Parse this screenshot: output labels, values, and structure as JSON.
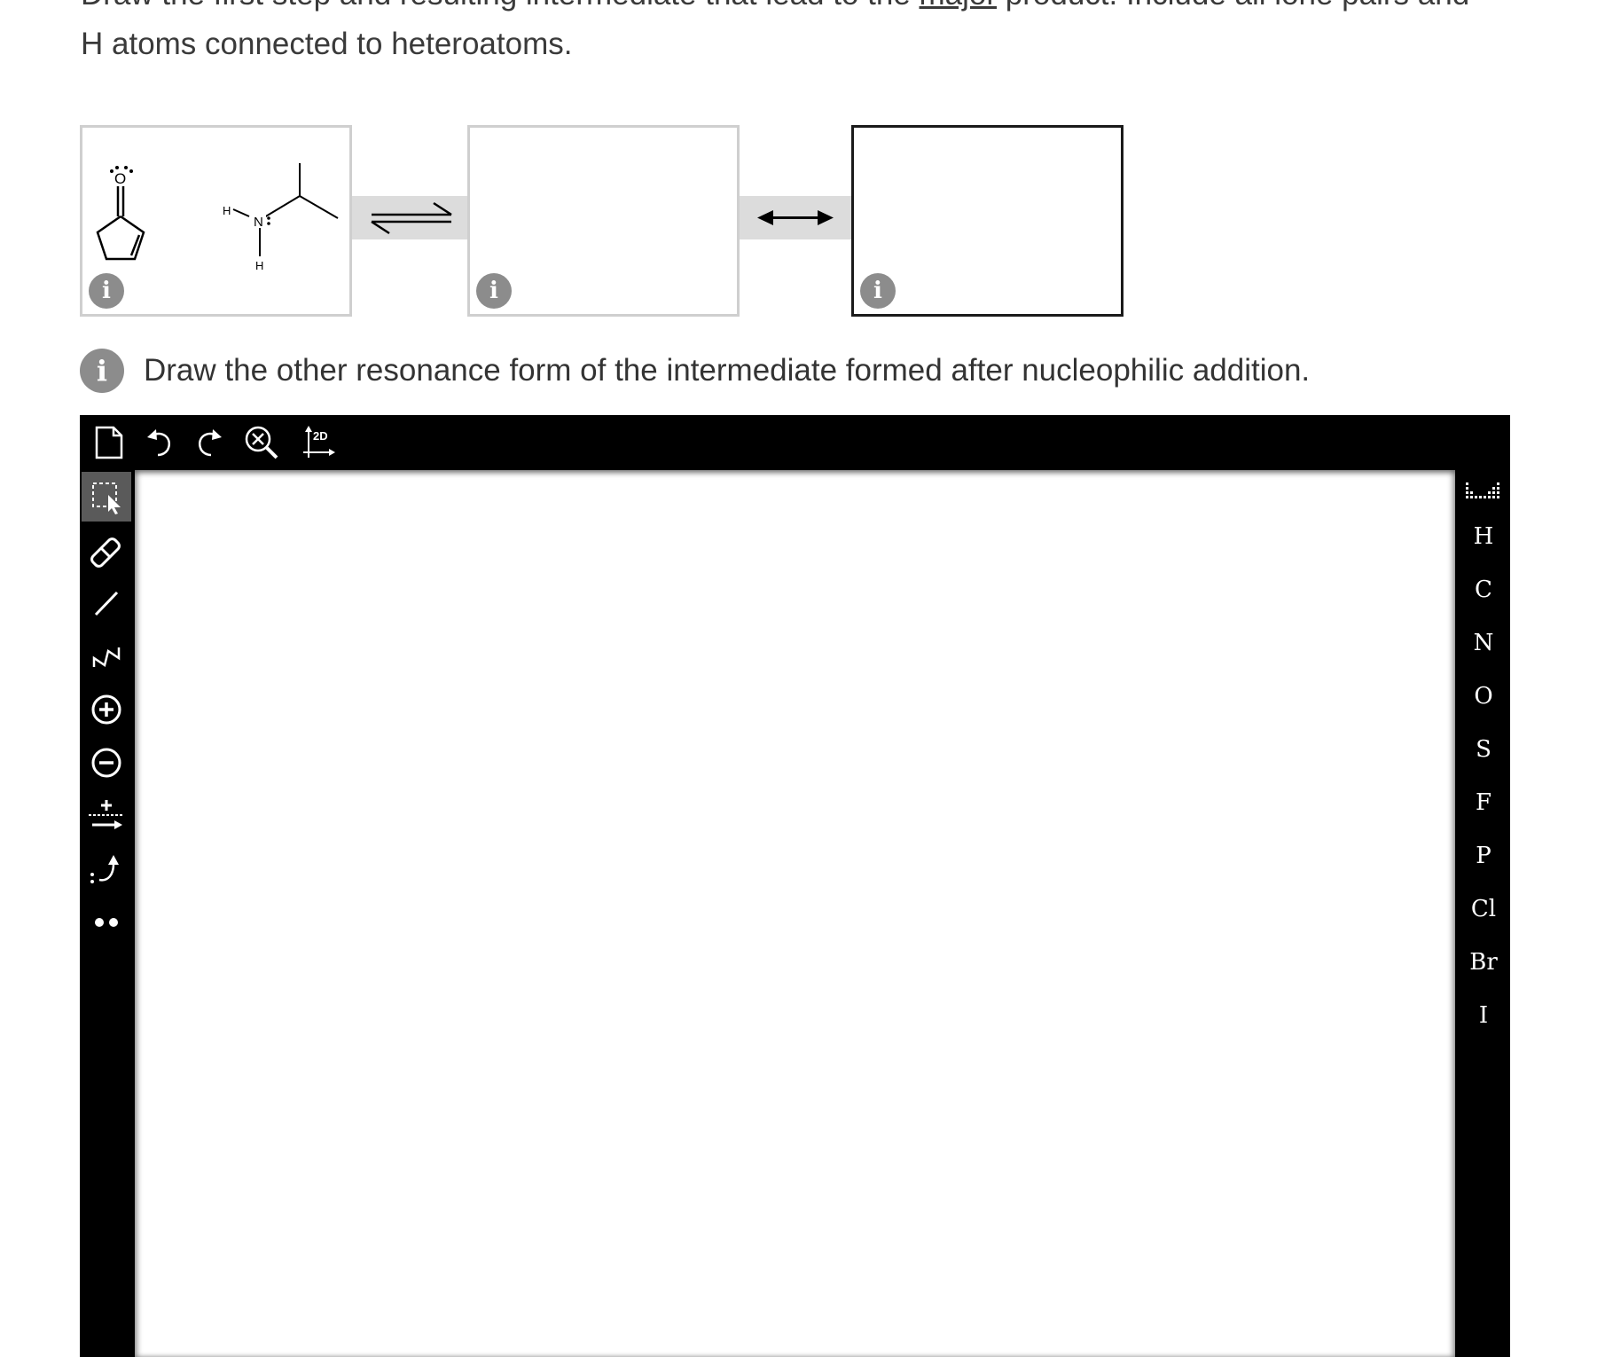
{
  "question": {
    "line1_before": "Draw the first step and resulting intermediate that lead to the ",
    "line1_underlined": "major",
    "line1_after": " product. Include all lone pairs and",
    "line2": "H atoms connected to heteroatoms."
  },
  "reaction": {
    "info_glyph": "i",
    "box1_molecule_labels": {
      "oxygen": "O",
      "nitrogen": "N",
      "h_left": "H",
      "h_bottom": "H"
    },
    "connector1_icon": "equilibrium-arrows-icon",
    "connector2_icon": "resonance-double-arrow-icon"
  },
  "hint": {
    "info_glyph": "i",
    "text": "Draw the other resonance form of the intermediate formed after nucleophilic addition."
  },
  "editor": {
    "top_toolbar": [
      {
        "name": "new-document-icon"
      },
      {
        "name": "undo-icon"
      },
      {
        "name": "redo-icon"
      },
      {
        "name": "zoom-clear-icon"
      },
      {
        "name": "clean-2d-icon",
        "label": "2D"
      }
    ],
    "left_toolbar": [
      {
        "name": "select-tool-icon",
        "selected": true
      },
      {
        "name": "eraser-icon"
      },
      {
        "name": "single-bond-icon"
      },
      {
        "name": "chain-tool-icon"
      },
      {
        "name": "positive-charge-icon"
      },
      {
        "name": "negative-charge-icon"
      },
      {
        "name": "reaction-arrow-tool-icon"
      },
      {
        "name": "curved-arrow-icon"
      },
      {
        "name": "lone-pair-icon"
      }
    ],
    "elements": [
      "H",
      "C",
      "N",
      "O",
      "S",
      "F",
      "P",
      "Cl",
      "Br",
      "I"
    ],
    "periodic_table_icon": "periodic-table-icon"
  }
}
